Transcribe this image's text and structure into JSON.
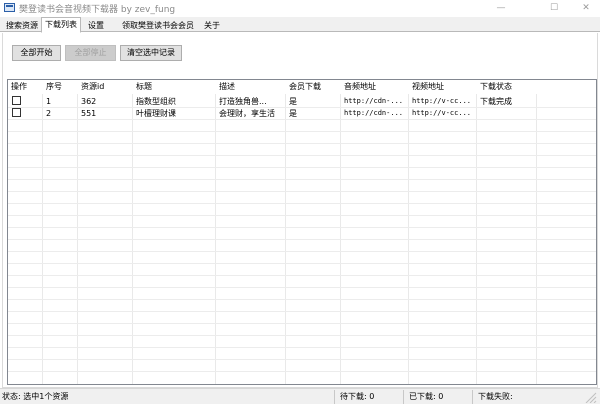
{
  "window": {
    "title": "樊登读书会音视频下载器 by zev_fung",
    "minimize_glyph": "—",
    "maximize_glyph": "☐",
    "close_glyph": "✕"
  },
  "tabs": [
    {
      "label": "搜索资源"
    },
    {
      "label": "下载列表"
    },
    {
      "label": "设置"
    },
    {
      "label": "领取樊登读书会会员"
    },
    {
      "label": "关于"
    }
  ],
  "toolbar": {
    "start_all": "全部开始",
    "stop_all": "全部停止",
    "clear_selected": "清空选中记录"
  },
  "table": {
    "columns": [
      "操作",
      "序号",
      "资源id",
      "标题",
      "描述",
      "会员下载",
      "音频地址",
      "视频地址",
      "下载状态"
    ],
    "rows": [
      {
        "checked": false,
        "index": "1",
        "resource_id": "362",
        "title": "指数型组织",
        "desc": "打造独角兽...",
        "vip": "是",
        "audio_url": "http://cdn-...",
        "video_url": "http://v-cc...",
        "status": "下载完成"
      },
      {
        "checked": false,
        "index": "2",
        "resource_id": "551",
        "title": "叶檀理财课",
        "desc": "会理财，享生活",
        "vip": "是",
        "audio_url": "http://cdn-...",
        "video_url": "http://v-cc...",
        "status": ""
      }
    ]
  },
  "statusbar": {
    "status": "状态:  选中1个资源",
    "pending": "待下载: 0",
    "done": "已下载: 0",
    "failed": "下载失败:"
  },
  "colors": {
    "tab_border": "#b9b9b9",
    "button_face": "#e1e1e1",
    "grid_border": "#828790",
    "chrome_bg": "#f0f0f0"
  },
  "icons": [
    "app-icon",
    "minimize-icon",
    "maximize-icon",
    "close-icon",
    "checkbox-icon",
    "resize-grip-icon"
  ]
}
